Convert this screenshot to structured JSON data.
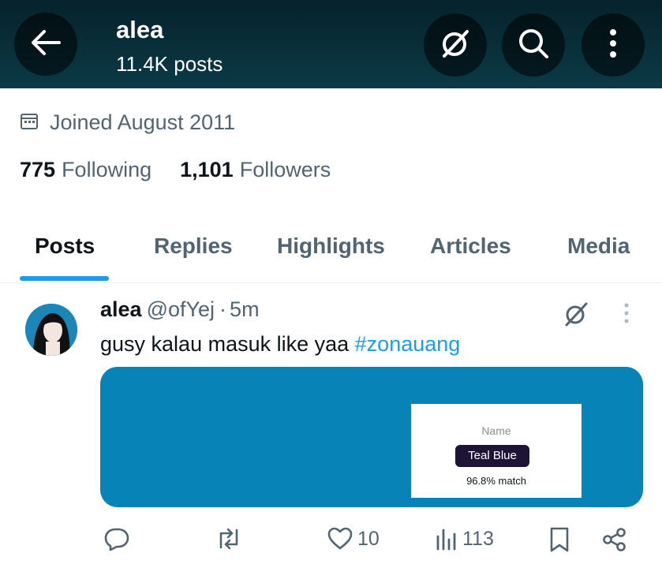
{
  "header": {
    "title": "alea",
    "subtitle": "11.4K posts",
    "bg_color": "#0b3a47"
  },
  "profile": {
    "joined": "Joined August 2011",
    "following_count": "775",
    "following_label": "Following",
    "followers_count": "1,101",
    "followers_label": "Followers"
  },
  "tabs": [
    {
      "label": "Posts",
      "active": true
    },
    {
      "label": "Replies",
      "active": false
    },
    {
      "label": "Highlights",
      "active": false
    },
    {
      "label": "Articles",
      "active": false
    },
    {
      "label": "Media",
      "active": false
    }
  ],
  "post": {
    "name": "alea",
    "handle": "@ofYej",
    "dot": "·",
    "time": "5m",
    "text": "gusy kalau masuk like yaa ",
    "hashtag": "#zonauang",
    "media": {
      "bg_color": "#0783b7",
      "card_label": "Name",
      "card_value": "Teal Blue",
      "card_match": "96.8% match"
    },
    "actions": {
      "likes": "10",
      "views": "113"
    }
  },
  "colors": {
    "accent": "#1d9bf0",
    "muted": "#536471"
  }
}
